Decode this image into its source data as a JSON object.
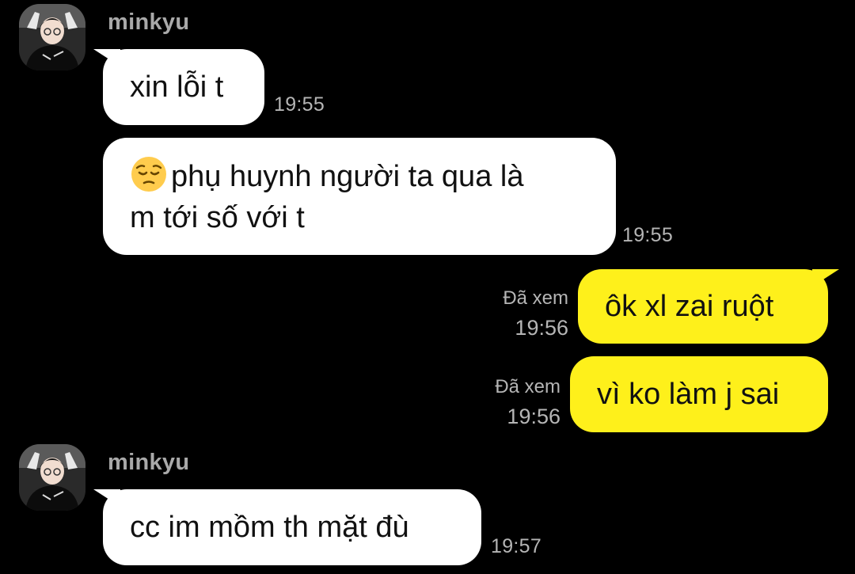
{
  "colors": {
    "background": "#000000",
    "incoming_bubble": "#ffffff",
    "outgoing_bubble": "#fef01b",
    "meta_text": "#b5b5b5"
  },
  "messages": [
    {
      "direction": "incoming",
      "sender": "minkyu",
      "lines": [
        "xin lỗi t"
      ],
      "time": "19:55"
    },
    {
      "direction": "incoming",
      "emoji": "pensive-face-icon",
      "lines": [
        "phụ huynh người ta qua là",
        "m tới số với t"
      ],
      "time": "19:55"
    },
    {
      "direction": "outgoing",
      "read_status": "Đã xem",
      "lines": [
        "ôk xl zai ruột"
      ],
      "time": "19:56"
    },
    {
      "direction": "outgoing",
      "read_status": "Đã xem",
      "lines": [
        "vì ko làm j sai"
      ],
      "time": "19:56"
    },
    {
      "direction": "incoming",
      "sender": "minkyu",
      "lines": [
        "cc im mồm th mặt đù"
      ],
      "time": "19:57"
    }
  ]
}
